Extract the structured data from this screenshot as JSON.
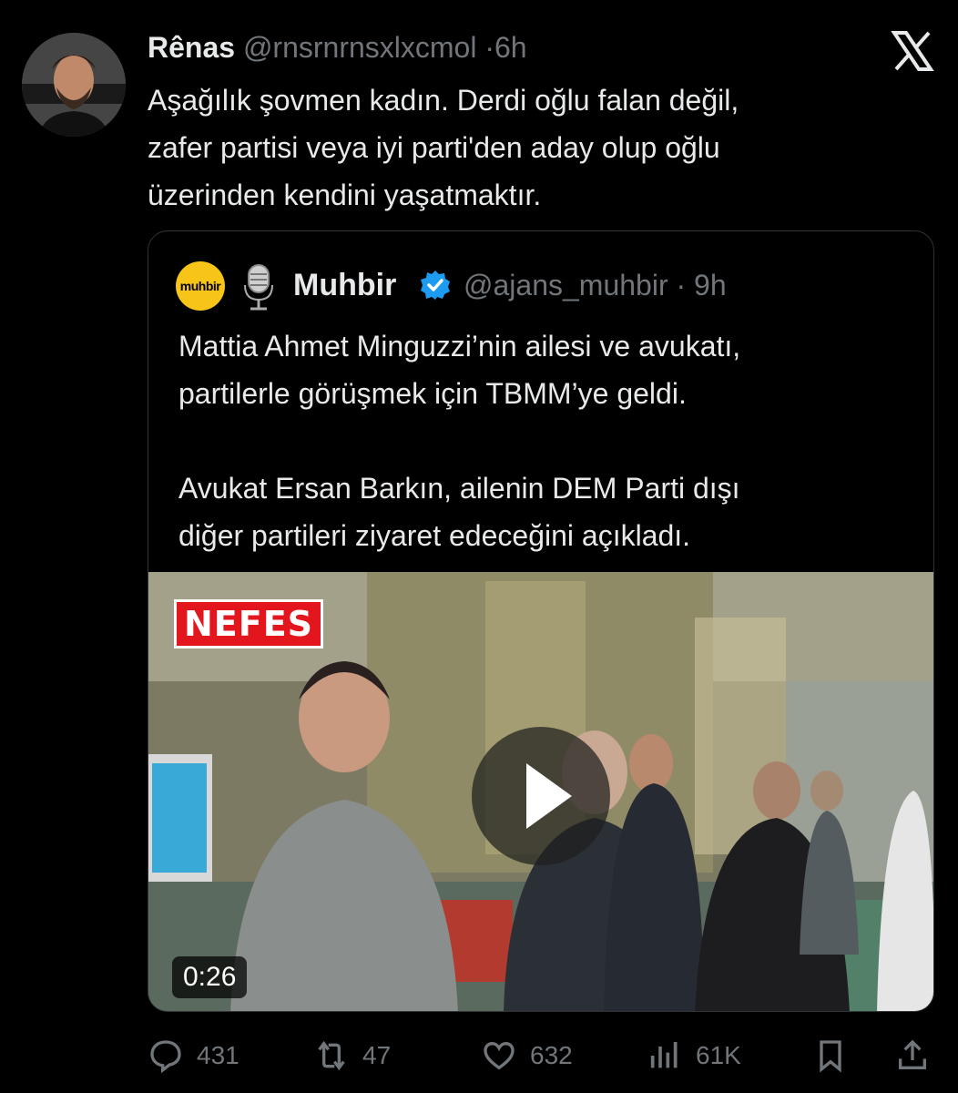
{
  "author": {
    "name": "Rênas",
    "handle": "@rnsrnrnsxlxcmol",
    "time": "6h"
  },
  "tweet": {
    "lines": [
      "Aşağılık şovmen kadın. Derdi oğlu falan değil,",
      "zafer partisi veya iyi parti'den aday olup oğlu",
      "üzerinden kendini yaşatmaktır."
    ]
  },
  "quoted": {
    "logo_text": "muhbir",
    "name": "Muhbir",
    "handle": "@ajans_muhbir",
    "time": "9h",
    "paragraph1": [
      "Mattia Ahmet Minguzzi’nin ailesi ve avukatı,",
      "partilerle görüşmek için TBMM’ye geldi."
    ],
    "paragraph2": [
      "Avukat Ersan Barkın, ailenin DEM Parti dışı",
      "diğer partileri ziyaret edeceğini açıkladı."
    ],
    "media": {
      "overlay_label": "NEFES",
      "duration": "0:26"
    }
  },
  "actions": {
    "replies": "431",
    "reposts": "47",
    "likes": "632",
    "views": "61K"
  },
  "icons": [
    "x-logo-icon",
    "verified-icon",
    "microphone-icon",
    "play-icon",
    "reply-icon",
    "repost-icon",
    "like-icon",
    "views-icon",
    "bookmark-icon",
    "share-icon"
  ],
  "colors": {
    "background": "#000000",
    "text": "#e7e9ea",
    "muted": "#71767b",
    "verified": "#1d9bf0",
    "logo": "#f6c517",
    "overlay_red": "#e3161d"
  }
}
